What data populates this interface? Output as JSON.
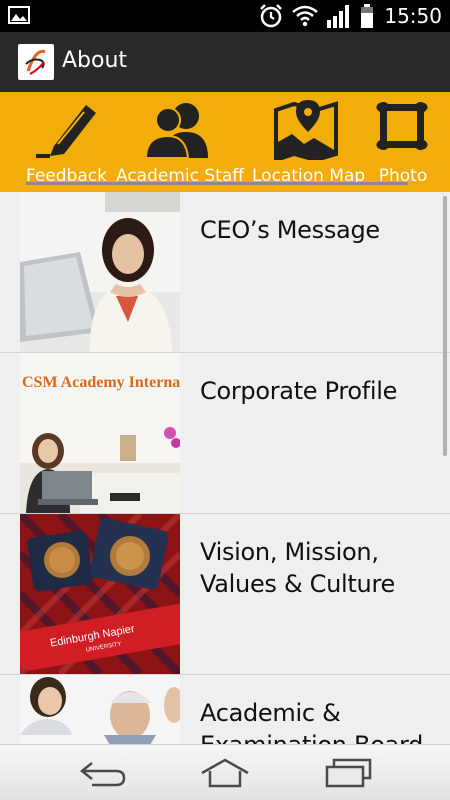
{
  "status_bar": {
    "time": "15:50",
    "icons": [
      "gallery-icon",
      "alarm-icon",
      "wifi-icon",
      "signal-icon",
      "battery-icon"
    ]
  },
  "action_bar": {
    "title": "About",
    "logo": "csm-logo-icon"
  },
  "tabs": [
    {
      "label": "Feedback",
      "icon": "pencil-icon"
    },
    {
      "label": "Academic Staff",
      "icon": "people-icon"
    },
    {
      "label": "Location Map",
      "icon": "map-pin-icon"
    },
    {
      "label": "Photo",
      "icon": "picture-frame-icon"
    }
  ],
  "list": {
    "items": [
      {
        "title": "CEO’s Message"
      },
      {
        "title": "Corporate Profile",
        "thumb_text": "CSM Academy Interna"
      },
      {
        "title": "Vision, Mission, Values & Culture",
        "thumb_text": "Edinburgh Napier",
        "thumb_subtext": "UNIVERSITY"
      },
      {
        "title": "Academic & Examination Board"
      }
    ]
  },
  "nav_bar": {
    "buttons": [
      "back-icon",
      "home-icon",
      "recent-apps-icon"
    ]
  },
  "colors": {
    "accent": "#f2ad09",
    "action_bar": "#2a2a2a",
    "status_bar": "#000000",
    "list_bg": "#efefef"
  }
}
